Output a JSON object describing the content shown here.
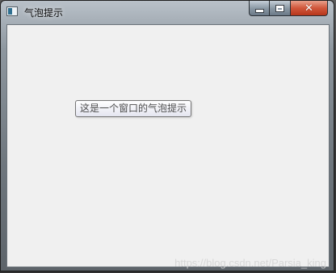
{
  "window": {
    "title": "气泡提示",
    "controls": {
      "minimize_icon": "minimize-icon",
      "maximize_icon": "maximize-icon",
      "close_icon": "close-icon",
      "close_glyph": "✕"
    }
  },
  "client": {
    "tooltip_text": "这是一个窗口的气泡提示"
  },
  "watermark": "https://blog.csdn.net/Parsia_king",
  "colors": {
    "client_background": "#f0f0f0",
    "close_button": "#c94a2e",
    "tooltip_border": "#767676"
  }
}
